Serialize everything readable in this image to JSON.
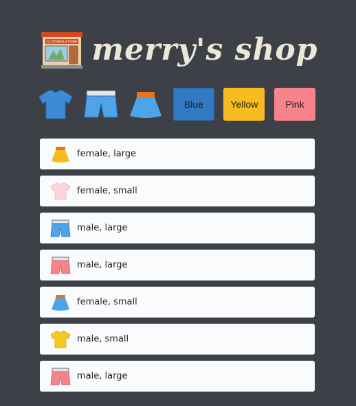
{
  "header": {
    "title": "merry's shop",
    "store_sign": "CLOTHING STORE",
    "store_icon": "clothing-store-icon"
  },
  "filters": {
    "types": [
      {
        "name": "tshirt-icon"
      },
      {
        "name": "shorts-icon"
      },
      {
        "name": "skirt-icon"
      }
    ],
    "colors": [
      {
        "label": "Blue",
        "hex": "#3179c2"
      },
      {
        "label": "Yellow",
        "hex": "#f7bc1f"
      },
      {
        "label": "Pink",
        "hex": "#f7838b"
      }
    ]
  },
  "items": [
    {
      "icon": "skirt-icon",
      "color": "#f7bc1f",
      "text": "female, large"
    },
    {
      "icon": "tshirt-icon",
      "color": "#fdd4d8",
      "text": "female, small"
    },
    {
      "icon": "shorts-icon",
      "color": "#4fa3ea",
      "text": "male, large"
    },
    {
      "icon": "shorts-icon",
      "color": "#f7838b",
      "text": "male, large"
    },
    {
      "icon": "skirt-icon",
      "color": "#4fa3ea",
      "text": "female, small"
    },
    {
      "icon": "tshirt-icon",
      "color": "#f7c91f",
      "text": "male, small"
    },
    {
      "icon": "shorts-icon",
      "color": "#f7838b",
      "text": "male, large"
    }
  ]
}
